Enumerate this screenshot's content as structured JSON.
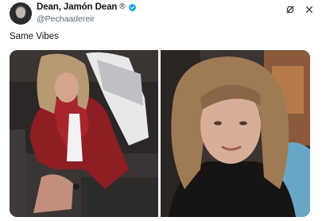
{
  "author": {
    "display_name": "Dean, Jamón Dean",
    "name_badge": "®",
    "handle": "@Pechaadereir"
  },
  "tweet": {
    "text": "Same Vibes"
  },
  "icons": {
    "avatar": "avatar",
    "verified": "verified-badge-icon",
    "grok": "grok-icon",
    "close": "close-icon"
  },
  "colors": {
    "verified": "#1d9bf0",
    "secondary_text": "#536471",
    "primary_text": "#0f1419"
  },
  "media": {
    "images": [
      {
        "name": "photo-left"
      },
      {
        "name": "photo-right"
      }
    ]
  }
}
